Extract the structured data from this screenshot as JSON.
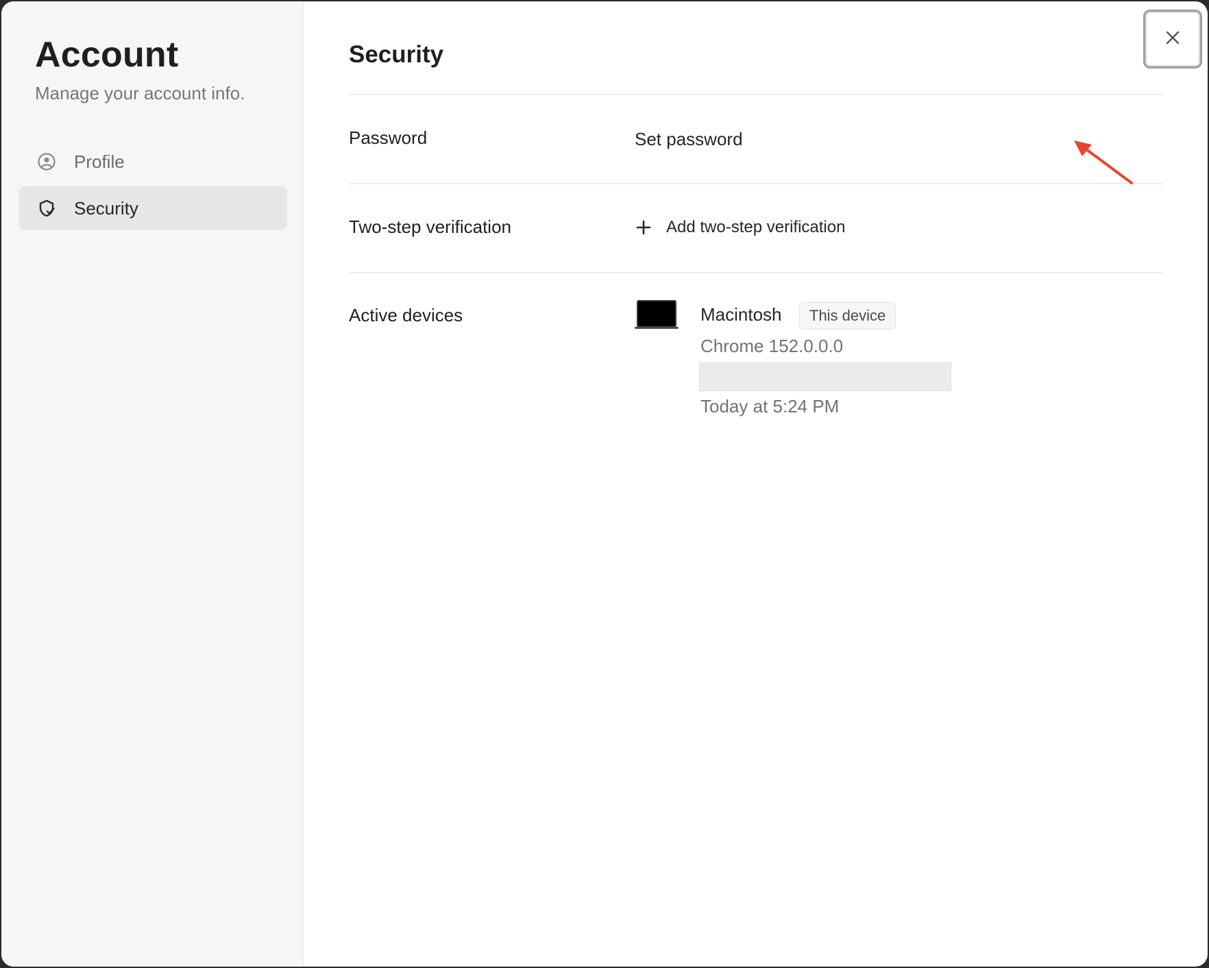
{
  "sidebar": {
    "title": "Account",
    "subtitle": "Manage your account info.",
    "items": [
      {
        "label": "Profile",
        "icon": "user-circle-icon",
        "active": false
      },
      {
        "label": "Security",
        "icon": "shield-check-icon",
        "active": true
      }
    ]
  },
  "main": {
    "title": "Security",
    "password": {
      "label": "Password",
      "action": "Set password"
    },
    "two_step": {
      "label": "Two-step verification",
      "action": "Add two-step verification",
      "icon": "plus-icon"
    },
    "devices": {
      "label": "Active devices",
      "items": [
        {
          "name": "Macintosh",
          "badge": "This device",
          "browser": "Chrome 152.0.0.0",
          "last_active": "Today at 5:24 PM",
          "icon": "laptop-icon"
        }
      ]
    }
  },
  "close": {
    "icon": "close-icon"
  },
  "colors": {
    "annotation_arrow": "#e8452c",
    "sidebar_bg": "#f6f6f6",
    "active_item_bg": "#e6e6e6"
  }
}
